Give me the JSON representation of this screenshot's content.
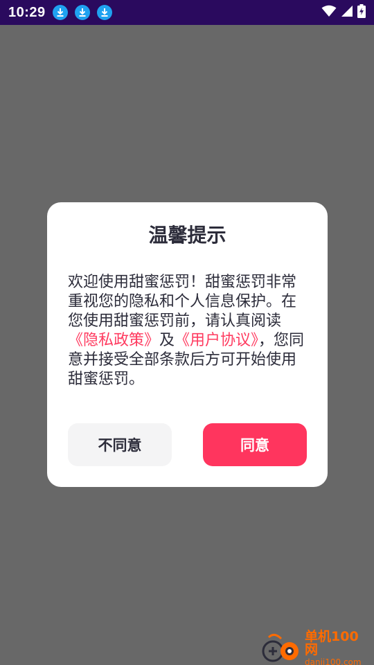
{
  "status_bar": {
    "time": "10:29",
    "download_icons": [
      "download-icon",
      "download-icon",
      "download-icon"
    ],
    "indicators": [
      "wifi-icon",
      "signal-icon",
      "battery-charging-icon"
    ],
    "background_color": "#2a0a5e"
  },
  "dialog": {
    "title": "温馨提示",
    "body_part1": "欢迎使用甜蜜惩罚！甜蜜惩罚非常重视您的隐私和个人信息保护。在您使用甜蜜惩罚前，请认真阅读",
    "privacy_link": "《隐私政策》",
    "body_part2": "及",
    "user_agreement_link": "《用户协议》",
    "body_part3": "，您同意并接受全部条款后方可开始使用甜蜜惩罚。",
    "disagree_label": "不同意",
    "agree_label": "同意",
    "accent_color": "#ff355e"
  },
  "watermark": {
    "name": "单机100网",
    "url": "danji100.com"
  }
}
